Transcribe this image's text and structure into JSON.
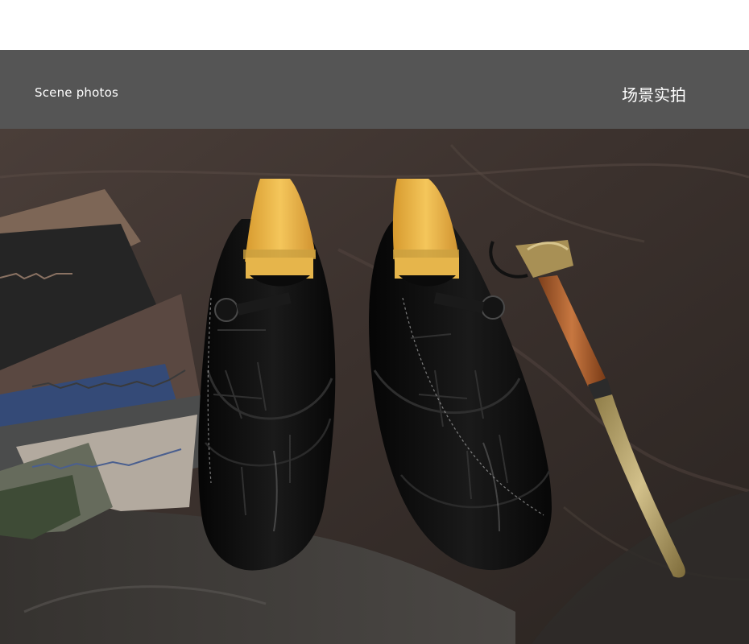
{
  "header": {
    "title_en": "Scene photos",
    "title_zh": "场景实拍"
  },
  "photo": {
    "subject": "black crocodile-embossed monk strap shoes with wooden shoe trees, fabric swatches and a long shoehorn on dark leather",
    "colors": {
      "header_bg": "#555555",
      "leather_bg": "#3a302c",
      "shoe": "#0b0b0b",
      "shoe_tree": "#e8b54a",
      "shoehorn_handle": "#b0602e",
      "shoehorn_blade": "#b8a46a"
    }
  }
}
